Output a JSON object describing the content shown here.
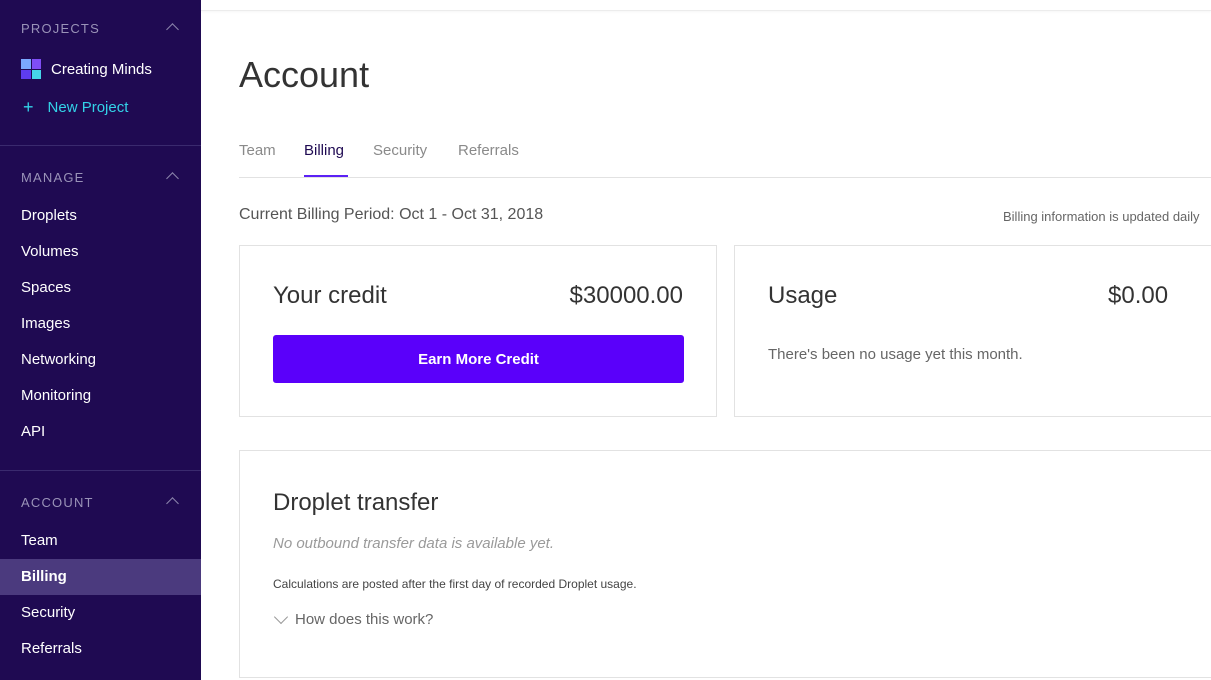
{
  "sidebar": {
    "projects_heading": "PROJECTS",
    "projects": [
      {
        "label": "Creating Minds",
        "icon": "project-grid-icon"
      }
    ],
    "new_project_label": "New Project",
    "manage_heading": "MANAGE",
    "manage_items": [
      "Droplets",
      "Volumes",
      "Spaces",
      "Images",
      "Networking",
      "Monitoring",
      "API"
    ],
    "account_heading": "ACCOUNT",
    "account_items": [
      "Team",
      "Billing",
      "Security",
      "Referrals"
    ],
    "active_item": "Billing"
  },
  "page": {
    "title": "Account",
    "tabs": [
      "Team",
      "Billing",
      "Security",
      "Referrals"
    ],
    "active_tab": "Billing",
    "billing_period": "Current Billing Period: Oct 1 - Oct 31, 2018",
    "updated_note": "Billing information is updated daily"
  },
  "credit_card": {
    "label": "Your credit",
    "value": "$30000.00",
    "button_label": "Earn More Credit"
  },
  "usage_card": {
    "label": "Usage",
    "value": "$0.00",
    "note": "There's been no usage yet this month."
  },
  "transfer_card": {
    "title": "Droplet transfer",
    "empty_note": "No outbound transfer data is available yet.",
    "calc_note": "Calculations are posted after the first day of recorded Droplet usage.",
    "how_label": "How does this work?"
  },
  "colors": {
    "sidebar_bg": "#1f0a52",
    "accent": "#5a00fa",
    "new_project": "#33d2e8",
    "active_nav_bg": "#4b3a7e"
  }
}
